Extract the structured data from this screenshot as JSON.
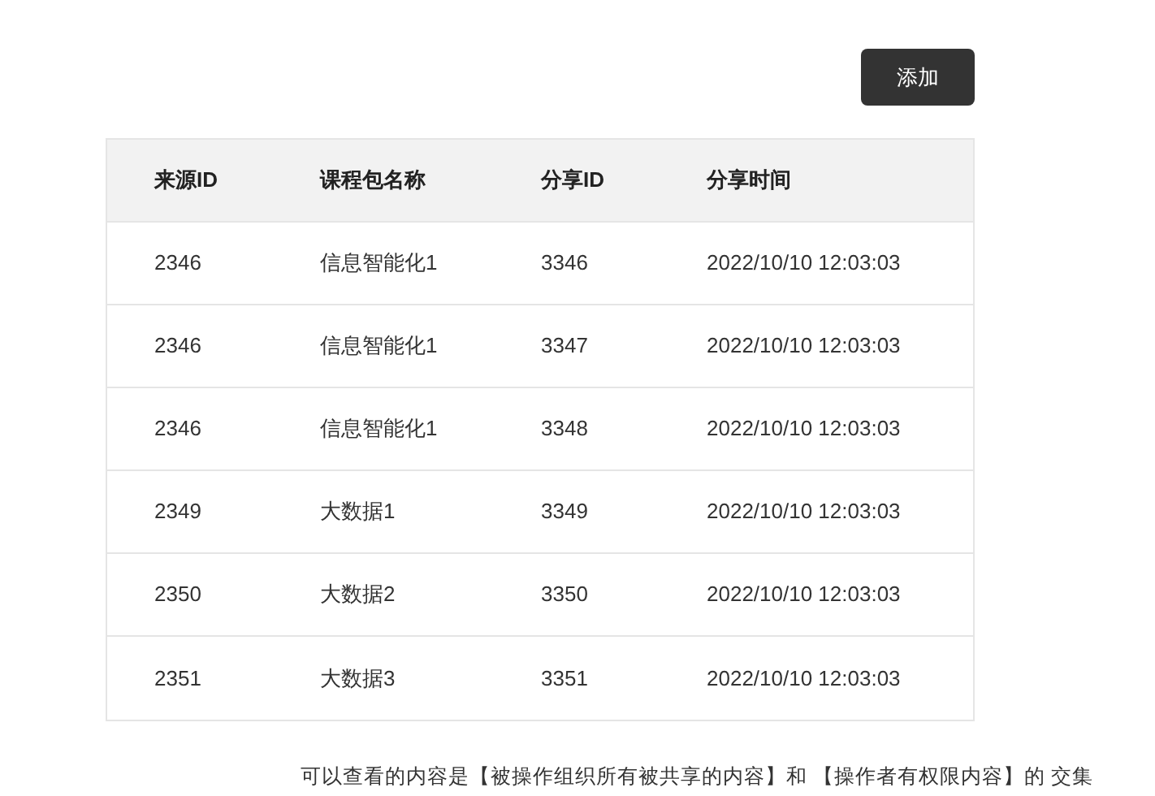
{
  "add_button": "添加",
  "table": {
    "columns": [
      "来源ID",
      "课程包名称",
      "分享ID",
      "分享时间"
    ],
    "rows": [
      [
        "2346",
        "信息智能化1",
        "3346",
        "2022/10/10 12:03:03"
      ],
      [
        "2346",
        "信息智能化1",
        "3347",
        "2022/10/10 12:03:03"
      ],
      [
        "2346",
        "信息智能化1",
        "3348",
        "2022/10/10 12:03:03"
      ],
      [
        "2349",
        "大数据1",
        "3349",
        "2022/10/10 12:03:03"
      ],
      [
        "2350",
        "大数据2",
        "3350",
        "2022/10/10 12:03:03"
      ],
      [
        "2351",
        "大数据3",
        "3351",
        "2022/10/10 12:03:03"
      ]
    ]
  },
  "note": "可以查看的内容是【被操作组织所有被共享的内容】和 【操作者有权限内容】的 交集"
}
